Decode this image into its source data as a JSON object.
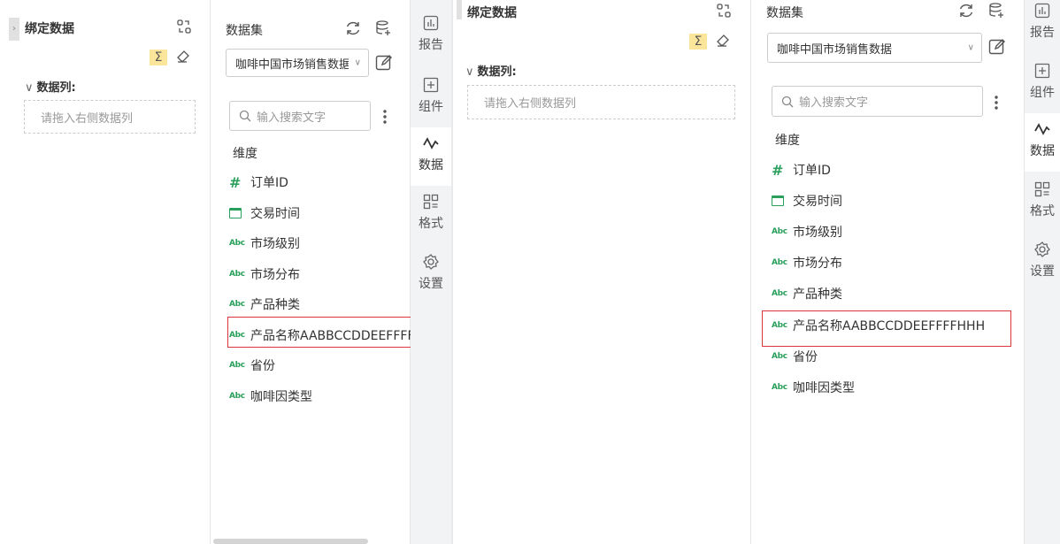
{
  "left": {
    "bind_panel": {
      "title": "绑定数据",
      "data_columns_label": "数据列:",
      "drop_placeholder": "请拖入右侧数据列"
    },
    "dataset_panel": {
      "title": "数据集",
      "selected_dataset": "咖啡中国市场销售数据",
      "search_placeholder": "输入搜索文字",
      "dimension_label": "维度",
      "fields": [
        {
          "type": "number",
          "label": "订单ID"
        },
        {
          "type": "date",
          "label": "交易时间"
        },
        {
          "type": "text",
          "label": "市场级别"
        },
        {
          "type": "text",
          "label": "市场分布"
        },
        {
          "type": "text",
          "label": "产品种类"
        },
        {
          "type": "text",
          "label": "产品名称AABBCCDDEEFFFFHHH"
        },
        {
          "type": "text",
          "label": "省份"
        },
        {
          "type": "text",
          "label": "咖啡因类型"
        }
      ]
    },
    "tabs": [
      "报告",
      "组件",
      "数据",
      "格式",
      "设置"
    ],
    "active_tab": "数据"
  },
  "right": {
    "bind_panel": {
      "title": "绑定数据",
      "data_columns_label": "数据列:",
      "drop_placeholder": "请拖入右侧数据列"
    },
    "dataset_panel": {
      "title": "数据集",
      "selected_dataset": "咖啡中国市场销售数据",
      "search_placeholder": "输入搜索文字",
      "dimension_label": "维度",
      "fields": [
        {
          "type": "number",
          "label": "订单ID"
        },
        {
          "type": "date",
          "label": "交易时间"
        },
        {
          "type": "text",
          "label": "市场级别"
        },
        {
          "type": "text",
          "label": "市场分布"
        },
        {
          "type": "text",
          "label": "产品种类"
        },
        {
          "type": "text",
          "label": "产品名称AABBCCDDEEFFFFHHH"
        },
        {
          "type": "text",
          "label": "省份"
        },
        {
          "type": "text",
          "label": "咖啡因类型"
        }
      ]
    },
    "tabs": [
      "报告",
      "组件",
      "数据",
      "格式",
      "设置"
    ],
    "active_tab": "数据"
  },
  "icons": {
    "sigma": "Σ",
    "text_field": "Abc",
    "number_field": "#"
  },
  "colors": {
    "field_icon": "#2aa05c",
    "highlight": "#d9363e",
    "sigma_bg": "#fbe59b"
  }
}
